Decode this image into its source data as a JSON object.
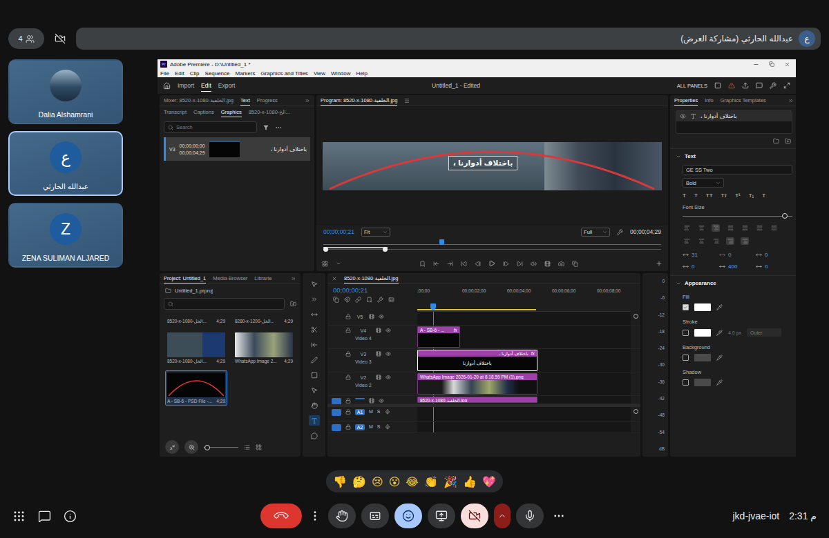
{
  "meet": {
    "participant_count": "4",
    "camera_blocked": true,
    "presenter_label": "عبدالله الحارثي (مشاركة العرض)",
    "presenter_avatar": "ع",
    "tiles": [
      {
        "name": "Dalia Alshamrani",
        "avatar": "",
        "kind": "photo",
        "active": false
      },
      {
        "name": "عبدالله الحارثي",
        "avatar": "ع",
        "kind": "letter",
        "active": true
      },
      {
        "name": "ZENA SULIMAN ALJARED",
        "avatar": "Z",
        "kind": "letter",
        "active": false
      }
    ],
    "reactions": [
      "👎",
      "🤔",
      "😢",
      "😮",
      "😂",
      "👏",
      "🎉",
      "👍",
      "💖"
    ],
    "left_controls": [
      {
        "kind": "activities"
      },
      {
        "kind": "chat"
      },
      {
        "kind": "info"
      }
    ],
    "controls": [
      {
        "kind": "end-call",
        "selected": false
      },
      {
        "kind": "more-options",
        "selected": false
      },
      {
        "kind": "raise-hand",
        "selected": false
      },
      {
        "kind": "captions",
        "selected": false
      },
      {
        "kind": "reactions",
        "selected": true
      },
      {
        "kind": "present",
        "selected": false
      },
      {
        "kind": "camera-off",
        "selected": false
      },
      {
        "kind": "camera-options",
        "selected": false
      },
      {
        "kind": "mic",
        "selected": false
      },
      {
        "kind": "more-audio",
        "selected": false
      }
    ],
    "meeting_code": "jkd-jvae-iot",
    "time": "2:31 م"
  },
  "premiere": {
    "logo": "Pr",
    "title": "Adobe Premiere - D:\\Untitled_1 *",
    "menu": [
      "File",
      "Edit",
      "Clip",
      "Sequence",
      "Markers",
      "Graphics and Titles",
      "View",
      "Window",
      "Help"
    ],
    "workspaces": [
      {
        "label": "Import",
        "selected": false
      },
      {
        "label": "Edit",
        "selected": true
      },
      {
        "label": "Export",
        "selected": false
      }
    ],
    "document_title": "Untitled_1 - Edited",
    "all_panels": "ALL PANELS",
    "source": {
      "tabs": [
        {
          "label": "Mixer: 8520-x-1080-الخلفية.jpg",
          "selected": false
        },
        {
          "label": "Text",
          "selected": true
        },
        {
          "label": "Progress",
          "selected": false
        }
      ],
      "subtabs": [
        {
          "label": "Transcript",
          "selected": false
        },
        {
          "label": "Captions",
          "selected": false
        },
        {
          "label": "Graphics",
          "selected": true
        },
        {
          "label": "8520-x-1080-الخ...",
          "selected": false
        }
      ],
      "search_placeholder": "Search",
      "items": [
        {
          "track": "V3",
          "start": "00;00;00;00",
          "end": "00;00;04;29",
          "text": "باختلاف أدوارنا ،",
          "selected": true
        }
      ]
    },
    "program": {
      "tab": "Program: 8520-x-1080-الخلفية.jpg",
      "overlay_text": "باختلاف أدوارنا ،",
      "timecode": "00;00;00;21",
      "fit": "Fit",
      "quality": "Full",
      "duration": "00;00;04;29",
      "playhead": 0.35,
      "zoom_level": 0.19
    },
    "properties": {
      "tabs": [
        {
          "label": "Properties",
          "selected": true
        },
        {
          "label": "Info",
          "selected": false
        },
        {
          "label": "Graphics Templates",
          "selected": false
        }
      ],
      "layer": "باختلاف أدوارنا ،",
      "section": "Text",
      "font": "GE SS Two",
      "style": "Bold",
      "type_buttons": [
        "T",
        "T",
        "TT",
        "Tт",
        "T¹",
        "T₁",
        "T"
      ],
      "font_size_label": "Font Size",
      "font_size_level": 0.93,
      "metrics": [
        {
          "value": "31",
          "disabled": false
        },
        {
          "value": "0",
          "disabled": true
        },
        {
          "value": "0",
          "disabled": false
        },
        {
          "value": "0",
          "disabled": false
        },
        {
          "value": "400",
          "disabled": false
        },
        {
          "value": "0",
          "disabled": false
        }
      ],
      "appearance": "Appearance",
      "appearance_items": [
        {
          "label": "Fill",
          "checked": true,
          "swatch": "#ffffff",
          "width": "",
          "position": ""
        },
        {
          "label": "Stroke",
          "checked": false,
          "swatch": "#ffffff",
          "width": "4.0 px",
          "position": "Outer"
        },
        {
          "label": "Background",
          "checked": false,
          "swatch": "#4a4a4a",
          "width": "",
          "position": ""
        },
        {
          "label": "Shadow",
          "checked": false,
          "swatch": "#4a4a4a",
          "width": "",
          "position": ""
        }
      ]
    },
    "project": {
      "tabs": [
        {
          "label": "Project: Untitled_1",
          "selected": true
        },
        {
          "label": "Media Browser",
          "selected": false
        },
        {
          "label": "Librarie",
          "selected": false
        }
      ],
      "file": "Untitled_1.prproj",
      "items": [
        {
          "name": "8520-x-1080-الخل...",
          "duration": "4;29",
          "kind": "cut",
          "selected": false
        },
        {
          "name": "8280-x-1200-الخل...",
          "duration": "4;29",
          "kind": "cut",
          "selected": false
        },
        {
          "name": "8520-x-1080-الخل...",
          "duration": "4;29",
          "kind": "banner",
          "selected": false
        },
        {
          "name": "WhatsApp Image 2...",
          "duration": "4;29",
          "kind": "photo",
          "selected": false
        },
        {
          "name": "A - SB-6 - PSD File -...",
          "duration": "4;29",
          "kind": "arc",
          "selected": true
        }
      ],
      "zoom_level": 0.1
    },
    "tools": [
      {
        "kind": "select",
        "selected": false
      },
      {
        "kind": "track-select",
        "selected": false
      },
      {
        "kind": "ripple",
        "selected": false
      },
      {
        "kind": "razor",
        "selected": false
      },
      {
        "kind": "slip",
        "selected": false
      },
      {
        "kind": "pen",
        "selected": false
      },
      {
        "kind": "rectangle",
        "selected": false
      },
      {
        "kind": "pointer",
        "selected": false
      },
      {
        "kind": "hand",
        "selected": false
      },
      {
        "kind": "type",
        "selected": true
      },
      {
        "kind": "caption",
        "selected": false
      }
    ],
    "timeline": {
      "tab": "8520-x-1080-الخلفية.jpg",
      "timecode": "00;00;00;21",
      "ruler": [
        ";00;00",
        "00;00;02;00",
        "00;00;04;00",
        "00;00;06;00",
        "00;00;08;00"
      ],
      "playhead_s": 0.7,
      "work_area_s": 5.3,
      "tracks": [
        {
          "id": "V5",
          "name": "",
          "kind": "video-short",
          "targeted": false,
          "source_patch": false,
          "mute_label": "",
          "solo_label": "",
          "clips": []
        },
        {
          "id": "V4",
          "name": "Video 4",
          "kind": "video",
          "targeted": false,
          "source_patch": false,
          "mute_label": "",
          "solo_label": "",
          "clips": [
            {
              "label": "A - SB-6 - ...",
              "start_s": 0,
              "duration_s": 1.9,
              "badge": "fx",
              "selected": false,
              "thumb": "dark",
              "thumb_text": ""
            }
          ]
        },
        {
          "id": "V3",
          "name": "Video 3",
          "kind": "video",
          "targeted": false,
          "source_patch": false,
          "mute_label": "",
          "solo_label": "",
          "clips": [
            {
              "label": "باختلاف أدوارنا ،",
              "start_s": 0,
              "duration_s": 5.35,
              "badge": "fx",
              "selected": true,
              "thumb": "dark",
              "thumb_text": "باختلاف أدوارنا"
            }
          ]
        },
        {
          "id": "V2",
          "name": "Video 2",
          "kind": "video",
          "targeted": false,
          "source_patch": false,
          "mute_label": "",
          "solo_label": "",
          "clips": [
            {
              "label": "WhatsApp Image 2026-01-20 at 8.18.59 PM (1).png",
              "start_s": 0,
              "duration_s": 5.35,
              "badge": "",
              "selected": false,
              "thumb": "photo",
              "thumb_text": ""
            }
          ]
        },
        {
          "id": "",
          "name": "",
          "kind": "video-cut",
          "targeted": true,
          "source_patch": true,
          "mute_label": "",
          "solo_label": "",
          "clips": [
            {
              "label": "8520-x-1080-الخلفية.jpg",
              "start_s": 0,
              "duration_s": 5.35,
              "badge": "",
              "selected": false,
              "thumb": "dark",
              "thumb_text": ""
            }
          ]
        },
        {
          "id": "A1",
          "name": "",
          "kind": "audio",
          "targeted": true,
          "source_patch": true,
          "mute_label": "M",
          "solo_label": "S",
          "clips": []
        },
        {
          "id": "A2",
          "name": "",
          "kind": "audio-cut",
          "targeted": true,
          "source_patch": true,
          "mute_label": "M",
          "solo_label": "S",
          "clips": []
        }
      ]
    },
    "meter": {
      "ticks": [
        "0",
        "-6",
        "-12",
        "-18",
        "-24",
        "-30",
        "-36",
        "-42",
        "-48",
        "-54"
      ],
      "unit": "dB"
    }
  }
}
